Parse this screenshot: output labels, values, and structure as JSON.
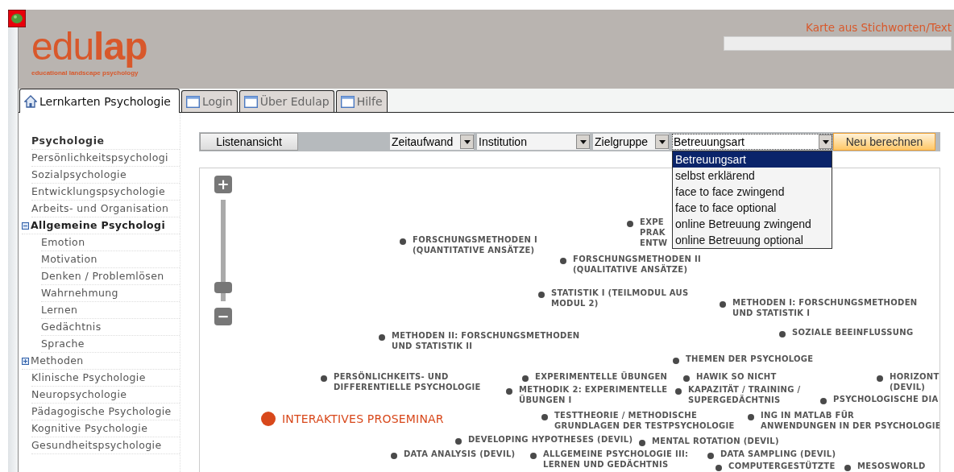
{
  "header": {
    "logo_light": "edu",
    "logo_bold": "lap",
    "tagline": "educational landscape psychology",
    "search_label": "Karte aus Stichworten/Text"
  },
  "tabs": [
    {
      "label": "Lernkarten Psychologie",
      "kind": "home",
      "selected": true
    },
    {
      "label": "Login",
      "kind": "window",
      "selected": false
    },
    {
      "label": "Über Edulap",
      "kind": "window",
      "selected": false
    },
    {
      "label": "Hilfe",
      "kind": "window",
      "selected": false
    }
  ],
  "sidebar": {
    "title": "Psychologie",
    "items": [
      {
        "label": "Persönlichkeitspsychologi"
      },
      {
        "label": "Sozialpsychologie"
      },
      {
        "label": "Entwicklungspsychologie"
      },
      {
        "label": "Arbeits- und Organisation"
      },
      {
        "label": "Allgemeine Psychologi",
        "expanded": true,
        "children": [
          {
            "label": "Emotion"
          },
          {
            "label": "Motivation"
          },
          {
            "label": "Denken / Problemlösen"
          },
          {
            "label": "Wahrnehmung"
          },
          {
            "label": "Lernen"
          },
          {
            "label": "Gedächtnis"
          },
          {
            "label": "Sprache"
          }
        ]
      },
      {
        "label": "Methoden",
        "expanded": false
      },
      {
        "label": "Klinische Psychologie"
      },
      {
        "label": "Neuropsychologie"
      },
      {
        "label": "Pädagogische Psychologie"
      },
      {
        "label": "Kognitive Psychologie"
      },
      {
        "label": "Gesundheitspsychologie"
      }
    ]
  },
  "toolbar": {
    "list_button": "Listenansicht",
    "filters": [
      {
        "value": "Zeitaufwand",
        "open": false
      },
      {
        "value": "Institution",
        "open": false
      },
      {
        "value": "Zielgruppe",
        "open": false
      },
      {
        "value": "Betreuungsart",
        "open": true,
        "options": [
          {
            "label": "Betreuungsart",
            "selected": true
          },
          {
            "label": "selbst erklärend",
            "selected": false
          },
          {
            "label": "face to face zwingend",
            "selected": false
          },
          {
            "label": "face to face optional",
            "selected": false
          },
          {
            "label": "online Betreuung zwingend",
            "selected": false
          },
          {
            "label": "online Betreuung optional",
            "selected": false
          }
        ]
      }
    ],
    "recalc_button": "Neu berechnen"
  },
  "map": {
    "zoom": {
      "plus": "+",
      "minus": "−",
      "level": 0.08
    },
    "nodes": [
      {
        "lines": [
          "EXPE",
          "PRAK",
          "ENTW"
        ],
        "highlighted": false
      },
      {
        "lines": [
          "FORSCHUNGSMETHODEN I",
          "(QUANTITATIVE ANSÄTZE)"
        ],
        "highlighted": false
      },
      {
        "lines": [
          "FORSCHUNGSMETHODEN II",
          "(QUALITATIVE ANSÄTZE)"
        ],
        "highlighted": false
      },
      {
        "lines": [
          "STATISTIK I (TEILMODUL AUS",
          "MODUL 2)"
        ],
        "highlighted": false
      },
      {
        "lines": [
          "METHODEN I: FORSCHUNGSMETHODEN",
          "UND STATISTIK I"
        ],
        "highlighted": false
      },
      {
        "lines": [
          "SOZIALE BEEINFLUSSUNG"
        ],
        "highlighted": false
      },
      {
        "lines": [
          "METHODEN II: FORSCHUNGSMETHODEN",
          "UND STATISTIK II"
        ],
        "highlighted": false
      },
      {
        "lines": [
          "THEMEN DER PSYCHOLOGE"
        ],
        "highlighted": false
      },
      {
        "lines": [
          "PERSÖNLICHKEITS- UND",
          "DIFFERENTIELLE PSYCHOLOGIE"
        ],
        "highlighted": false
      },
      {
        "lines": [
          "EXPERIMENTELLE ÜBUNGEN"
        ],
        "highlighted": false
      },
      {
        "lines": [
          "HAWIK SO NICHT"
        ],
        "highlighted": false
      },
      {
        "lines": [
          "HORIZONT",
          "(DEVIL)"
        ],
        "highlighted": false
      },
      {
        "lines": [
          "METHODIK 2: EXPERIMENTELLE",
          "ÜBUNGEN I"
        ],
        "highlighted": false
      },
      {
        "lines": [
          "KAPAZITÄT / TRAINING /",
          "SUPERGEDÄCHTNIS"
        ],
        "highlighted": false
      },
      {
        "lines": [
          "PSYCHOLOGISCHE DIA"
        ],
        "highlighted": false
      },
      {
        "lines": [
          "INTERAKTIVES PROSEMINAR"
        ],
        "highlighted": true
      },
      {
        "lines": [
          "TESTTHEORIE / METHODISCHE",
          "GRUNDLAGEN DER TESTPSYCHOLOGIE"
        ],
        "highlighted": false
      },
      {
        "lines": [
          "ING IN MATLAB FÜR",
          "ANWENDUNGEN IN DER PSYCHOLOGIE"
        ],
        "highlighted": false
      },
      {
        "lines": [
          "DEVELOPING HYPOTHESES (DEVIL)"
        ],
        "highlighted": false
      },
      {
        "lines": [
          "MENTAL ROTATION (DEVIL)"
        ],
        "highlighted": false
      },
      {
        "lines": [
          "DATA ANALYSIS (DEVIL)"
        ],
        "highlighted": false
      },
      {
        "lines": [
          "ALLGEMEINE PSYCHOLOGIE III:",
          "LERNEN UND GEDÄCHTNIS"
        ],
        "highlighted": false
      },
      {
        "lines": [
          "DATA SAMPLING (DEVIL)"
        ],
        "highlighted": false
      },
      {
        "lines": [
          "COMPUTERGESTÜTZTE"
        ],
        "highlighted": false
      },
      {
        "lines": [
          "MESOSWORLD"
        ],
        "highlighted": false
      }
    ]
  }
}
